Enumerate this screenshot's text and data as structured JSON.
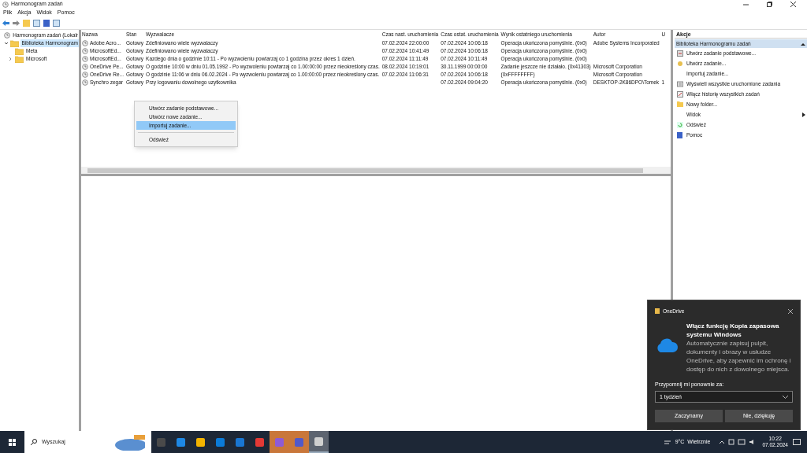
{
  "window": {
    "title": "Harmonogram zadań"
  },
  "menu": [
    "Plik",
    "Akcja",
    "Widok",
    "Pomoc"
  ],
  "tree": [
    {
      "label": "Harmonogram zadań (Lokalr",
      "selected": false,
      "children": [
        {
          "label": "Biblioteka Harmonogram",
          "selected": true,
          "expanded": true,
          "children": [
            {
              "label": "Meta",
              "selected": false
            },
            {
              "label": "Microsoft",
              "selected": false,
              "expanded": false
            }
          ]
        }
      ]
    }
  ],
  "table": {
    "columns": [
      "Nazwa",
      "Stan",
      "Wyzwalacze",
      "Czas nast. uruchomienia",
      "Czas ostat. uruchomienia",
      "Wynik ostatniego uruchomienia",
      "Autor",
      "U"
    ],
    "rows": [
      [
        "Adobe Acro...",
        "Gotowy",
        "Zdefiniowano wiele wyzwalaczy",
        "07.02.2024 22:00:00",
        "07.02.2024 10:06:18",
        "Operacja ukończona pomyślnie. (0x0)",
        "Adobe Systems Incorporated",
        ""
      ],
      [
        "MicrosoftEd...",
        "Gotowy",
        "Zdefiniowano wiele wyzwalaczy",
        "07.02.2024 10:41:49",
        "07.02.2024 10:06:18",
        "Operacja ukończona pomyślnie. (0x0)",
        "",
        ""
      ],
      [
        "MicrosoftEd...",
        "Gotowy",
        "Kazdego dnia o godzinie 10:11 - Po wyzwoleniu powtarzaj co 1 godzina przez okres 1 dzień.",
        "07.02.2024 11:11:49",
        "07.02.2024 10:11:49",
        "Operacja ukończona pomyślnie. (0x0)",
        "",
        ""
      ],
      [
        "OneDrive Pe...",
        "Gotowy",
        "O godzinie 10:00 w dniu 01.05.1992 - Po wyzwoleniu powtarzaj co 1.00:00:00 przez nieokreślony czas.",
        "08.02.2024 10:19:01",
        "30.11.1999 00:00:00",
        "Zadanie jeszcze nie działało. (0x41303)",
        "Microsoft Corporation",
        ""
      ],
      [
        "OneDrive Re...",
        "Gotowy",
        "O godzinie 11:06 w dniu 06.02.2024 - Po wyzwoleniu powtarzaj co 1.00:00:00 przez nieokreślony czas.",
        "07.02.2024 11:06:31",
        "07.02.2024 10:06:18",
        "(0xFFFFFFFF)",
        "Microsoft Corporation",
        ""
      ],
      [
        "Synchro zegar",
        "Gotowy",
        "Przy logowaniu dowolnego uzytkownika",
        "",
        "07.02.2024 09:04:20",
        "Operacja ukończona pomyślnie. (0x0)",
        "DESKTOP-2K86DPO\\Tomek",
        "1"
      ]
    ]
  },
  "context_menu": [
    {
      "kind": "item",
      "label": "Utwórz zadanie podstawowe...",
      "selected": false
    },
    {
      "kind": "item",
      "label": "Utwórz nowe zadanie...",
      "selected": false
    },
    {
      "kind": "item",
      "label": "Importuj zadanie...",
      "selected": true
    },
    {
      "kind": "separator"
    },
    {
      "kind": "item",
      "label": "Odśwież",
      "selected": false
    }
  ],
  "actions": {
    "title": "Akcje",
    "section": "Biblioteka Harmonogramu zadań",
    "expanded": true,
    "items": [
      {
        "kind": "item",
        "label": "Utwórz zadanie podstawowe..."
      },
      {
        "kind": "item",
        "label": "Utwórz zadanie..."
      },
      {
        "kind": "item",
        "label": "Importuj zadanie..."
      },
      {
        "kind": "item",
        "label": "Wyświetl wszystkie uruchomione zadania"
      },
      {
        "kind": "item",
        "label": "Włącz historię wszystkich zadań"
      },
      {
        "kind": "item",
        "label": "Nowy folder..."
      },
      {
        "kind": "submenu",
        "label": "Widok"
      },
      {
        "kind": "item",
        "label": "Odśwież"
      },
      {
        "kind": "item",
        "label": "Pomoc"
      }
    ]
  },
  "toast": {
    "app": "OneDrive",
    "title": "Włącz funkcję Kopia zapasowa systemu Windows",
    "body": "Automatycznie zapisuj pulpit, dokumenty i obrazy w usłudze OneDrive, aby zapewnić im ochronę i dostęp do nich z dowolnego miejsca.",
    "label": "Przypomnij mi ponownie za:",
    "select_value": "1 tydzień",
    "buttons": [
      "Zaczynamy",
      "Nie, dziękuję"
    ]
  },
  "taskbar": {
    "search_placeholder": "Wyszukaj",
    "apps": [
      {
        "flashing": false,
        "active": false
      },
      {
        "flashing": false,
        "active": false
      },
      {
        "flashing": false,
        "active": false
      },
      {
        "flashing": false,
        "active": false
      },
      {
        "flashing": false,
        "active": false
      },
      {
        "flashing": false,
        "active": false
      },
      {
        "flashing": true,
        "active": false
      },
      {
        "flashing": true,
        "active": false
      },
      {
        "flashing": false,
        "active": true
      }
    ],
    "weather": "9°C  Wietrznie",
    "time": "10:22",
    "date": "07.02.2024"
  }
}
